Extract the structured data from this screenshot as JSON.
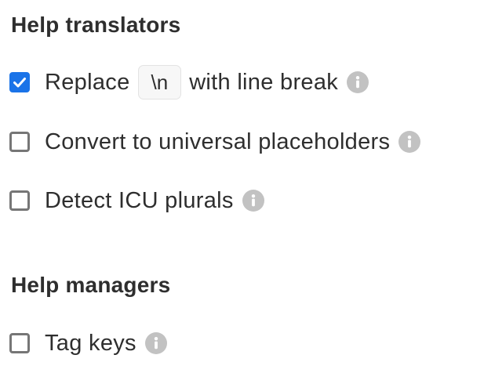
{
  "translators_section": {
    "title": "Help translators",
    "options": [
      {
        "label": "Replace",
        "code": "\\n",
        "label_after": "with line break",
        "checked": true
      },
      {
        "label": "Convert to universal placeholders",
        "checked": false
      },
      {
        "label": "Detect ICU plurals",
        "checked": false
      }
    ]
  },
  "managers_section": {
    "title": "Help managers",
    "options": [
      {
        "label": "Tag keys",
        "checked": false
      }
    ]
  },
  "icons": {
    "info": "info-icon",
    "check": "check-icon"
  },
  "colors": {
    "checkbox_checked": "#1a73e8",
    "checkbox_border": "#767676",
    "info_icon": "#c2c2c2",
    "text": "#2e2e2e"
  }
}
